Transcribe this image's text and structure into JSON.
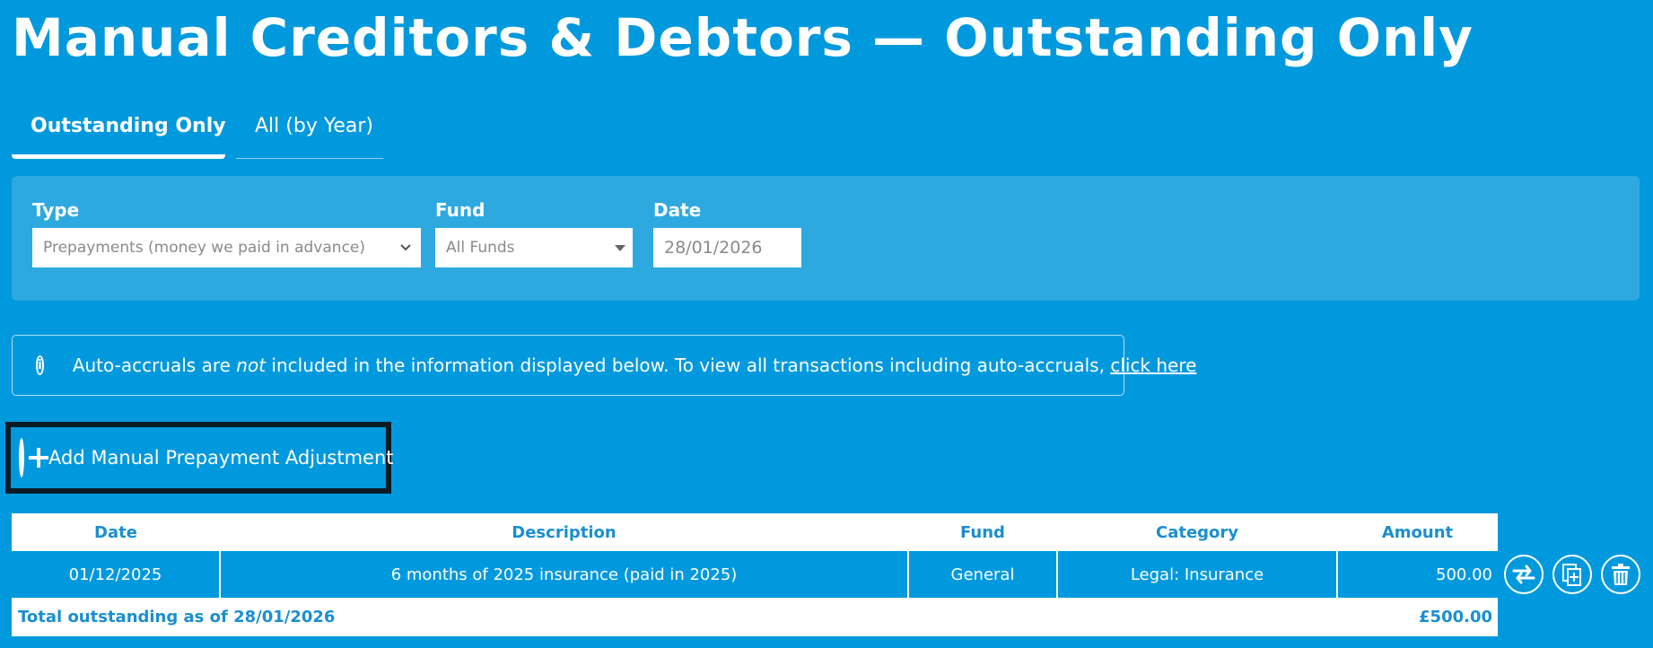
{
  "header": {
    "title": "Manual Creditors & Debtors — Outstanding Only"
  },
  "tabs": [
    {
      "label": "Outstanding Only",
      "active": true
    },
    {
      "label": "All (by Year)",
      "active": false
    }
  ],
  "filters": {
    "type": {
      "label": "Type",
      "value": "Prepayments (money we paid in advance)"
    },
    "fund": {
      "label": "Fund",
      "value": "All Funds"
    },
    "date": {
      "label": "Date",
      "value": "28/01/2026"
    }
  },
  "info": {
    "text_before": "Auto-accruals are ",
    "emphasis": "not",
    "text_after": " included in the information displayed below. To view all transactions including auto-accruals, ",
    "link": "click here"
  },
  "add_button": {
    "label": "Add Manual Prepayment Adjustment"
  },
  "table": {
    "columns": [
      "Date",
      "Description",
      "Fund",
      "Category",
      "Amount"
    ],
    "rows": [
      {
        "date": "01/12/2025",
        "description": "6 months of 2025 insurance (paid in 2025)",
        "fund": "General",
        "category": "Legal: Insurance",
        "amount": "500.00"
      }
    ],
    "total_label": "Total outstanding as of 28/01/2026",
    "total_value": "£500.00"
  },
  "row_actions": [
    "transfer-icon",
    "duplicate-icon",
    "trash-icon"
  ]
}
